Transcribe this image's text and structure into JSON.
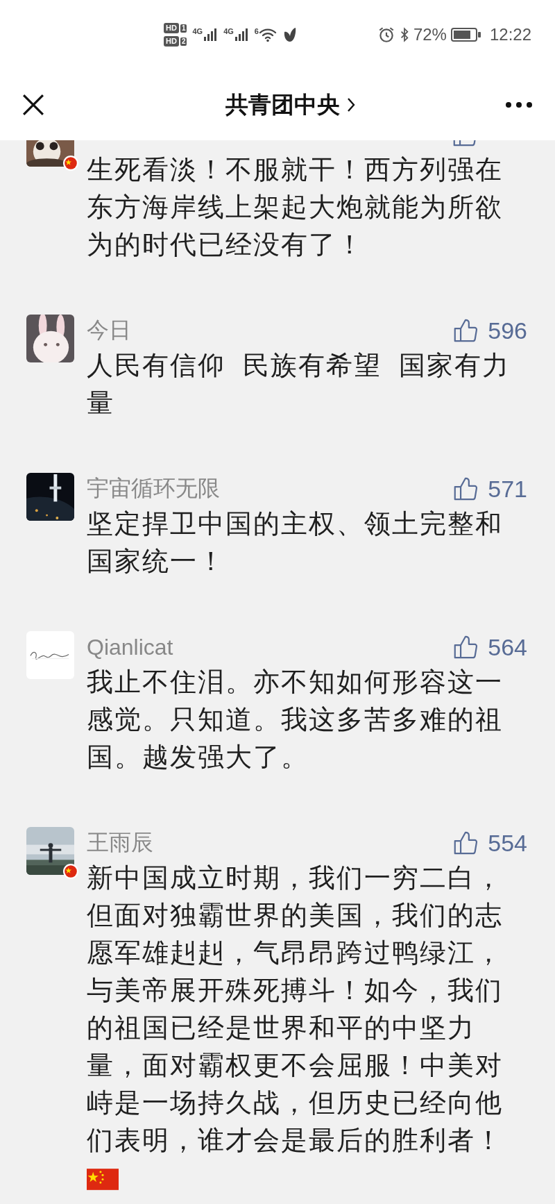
{
  "status_bar": {
    "sim_badges": [
      {
        "label": "HD",
        "slot": "1"
      },
      {
        "label": "HD",
        "slot": "2"
      }
    ],
    "networks": [
      "4G",
      "4G"
    ],
    "wifi_label": "6",
    "battery": "72%",
    "time": "12:22"
  },
  "header": {
    "title": "共青团中央"
  },
  "comments": [
    {
      "kind": "partial",
      "flag_badge": true,
      "text": "生死看淡！不服就干！西方列强在东方海岸线上架起大炮就能为所欲为的时代已经没有了！",
      "trailing_flag": false
    },
    {
      "kind": "full",
      "flag_badge": false,
      "name": "今日",
      "likes": "596",
      "text": "人民有信仰  民族有希望  国家有力量",
      "trailing_flag": false
    },
    {
      "kind": "full",
      "flag_badge": false,
      "name": "宇宙循环无限",
      "likes": "571",
      "text": "坚定捍卫中国的主权、领土完整和国家统一！",
      "trailing_flag": false
    },
    {
      "kind": "full",
      "flag_badge": false,
      "name": "Qianlicat",
      "likes": "564",
      "text": "我止不住泪。亦不知如何形容这一感觉。只知道。我这多苦多难的祖国。越发强大了。",
      "trailing_flag": false
    },
    {
      "kind": "full",
      "flag_badge": true,
      "name": "王雨辰",
      "likes": "554",
      "text": "新中国成立时期，我们一穷二白，但面对独霸世界的美国，我们的志愿军雄赳赳，气昂昂跨过鸭绿江，与美帝展开殊死搏斗！如今，我们的祖国已经是世界和平的中坚力量，面对霸权更不会屈服！中美对峙是一场持久战，但历史已经向他们表明，谁才会是最后的胜利者！",
      "trailing_flag": true
    }
  ]
}
